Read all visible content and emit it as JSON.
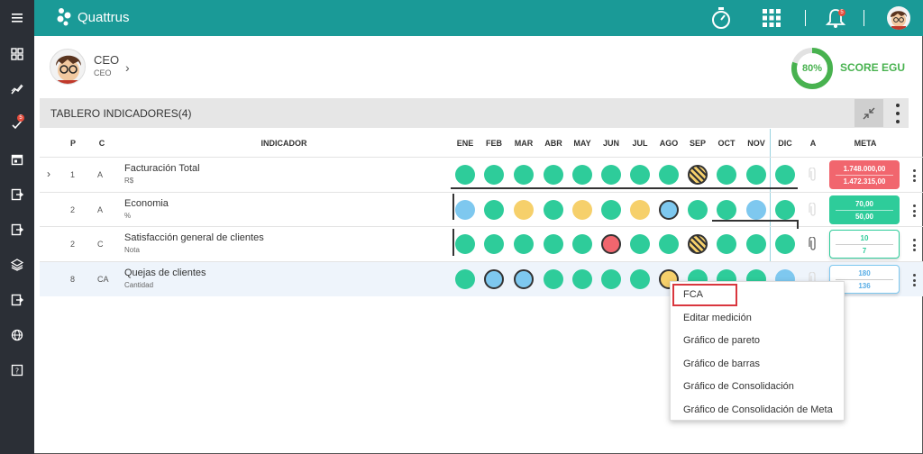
{
  "app": {
    "name": "Quattrus"
  },
  "sidebar": {
    "items": [
      "menu-icon",
      "dashboard-icon",
      "chart-line-icon",
      "tasks-icon",
      "calendar-icon",
      "login-icon",
      "export-icon",
      "layers-icon",
      "exit-icon",
      "globe-icon",
      "help-icon"
    ],
    "badge": "5"
  },
  "topbar": {
    "notifications_badge": "5"
  },
  "profile": {
    "name": "CEO",
    "role": "CEO"
  },
  "score": {
    "value": "80%",
    "percent": 80,
    "label": "SCORE EGU"
  },
  "panel": {
    "title": "TABLERO INDICADORES(4)"
  },
  "columns": {
    "p": "P",
    "c": "C",
    "indicador": "INDICADOR",
    "a": "A",
    "meta": "META",
    "months": [
      "ENE",
      "FEB",
      "MAR",
      "ABR",
      "MAY",
      "JUN",
      "JUL",
      "AGO",
      "SEP",
      "OCT",
      "NOV",
      "DIC"
    ]
  },
  "colors": {
    "green": "#2ecc9a",
    "yellow": "#f6d06b",
    "blue": "#7ec8ef",
    "red": "#f1666e",
    "teal": "#1a9a97"
  },
  "rows": [
    {
      "p": "1",
      "c": "A",
      "name": "Facturación Total",
      "unit": "R$",
      "dots": [
        "green",
        "green",
        "green",
        "green",
        "green",
        "green",
        "green",
        "green",
        "hatch",
        "green",
        "green",
        "green"
      ],
      "meta_top": "1.748.000,00",
      "meta_bottom": "1.472.315,00",
      "meta_style": "red"
    },
    {
      "p": "2",
      "c": "A",
      "name": "Economia",
      "unit": "%",
      "dots": [
        "blue",
        "green",
        "yellow",
        "green",
        "yellow",
        "green",
        "yellow",
        "blue",
        "green",
        "green",
        "blue",
        "green"
      ],
      "meta_top": "70,00",
      "meta_bottom": "50,00",
      "meta_style": "green"
    },
    {
      "p": "2",
      "c": "C",
      "name": "Satisfacción general de clientes",
      "unit": "Nota",
      "dots": [
        "green",
        "green",
        "green",
        "green",
        "green",
        "red",
        "green",
        "green",
        "hatch",
        "green",
        "green",
        "green"
      ],
      "meta_top": "10",
      "meta_bottom": "7",
      "meta_style": "green-outline"
    },
    {
      "p": "8",
      "c": "CA",
      "name": "Quejas de clientes",
      "unit": "Cantidad",
      "dots": [
        "green",
        "blue",
        "blue",
        "green",
        "green",
        "green",
        "green",
        "yellow",
        "green",
        "green",
        "green",
        "blue"
      ],
      "meta_top": "180",
      "meta_bottom": "136",
      "meta_style": "blue-outline"
    }
  ],
  "context_menu": {
    "items": [
      "FCA",
      "Editar medición",
      "Gráfico de pareto",
      "Gráfico de barras",
      "Gráfico de Consolidación",
      "Gráfico de Consolidación de Meta"
    ]
  }
}
